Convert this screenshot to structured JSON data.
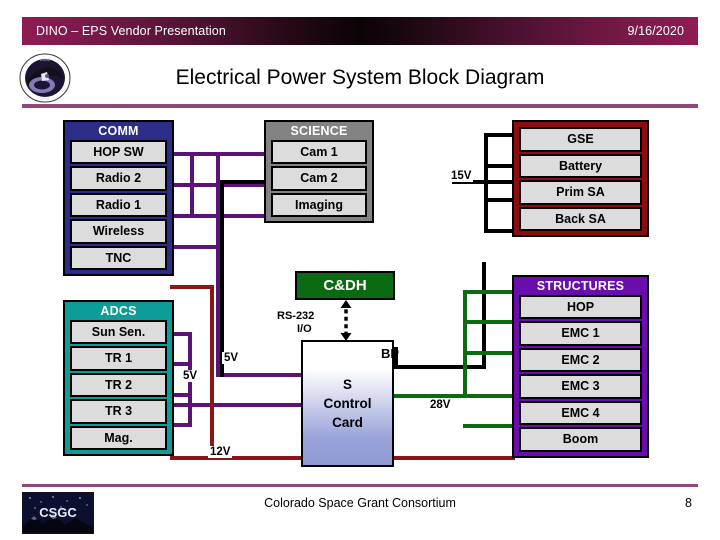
{
  "header": {
    "title": "DINO – EPS Vendor Presentation",
    "date": "9/16/2020"
  },
  "slide": {
    "title": "Electrical Power System Block Diagram"
  },
  "footer": {
    "organization": "Colorado Space Grant Consortium",
    "page_number": "8",
    "logo_text": "CSGC"
  },
  "diagram": {
    "groups": [
      {
        "name": "comm",
        "title": "COMM",
        "color": "#2b2d86",
        "items": [
          "HOP SW",
          "Radio 2",
          "Radio 1",
          "Wireless",
          "TNC"
        ]
      },
      {
        "name": "adcs",
        "title": "ADCS",
        "color": "#0e9c99",
        "items": [
          "Sun Sen.",
          "TR 1",
          "TR 2",
          "TR 3",
          "Mag."
        ]
      },
      {
        "name": "science",
        "title": "SCIENCE",
        "color": "#828282",
        "items": [
          "Cam 1",
          "Cam 2",
          "Imaging"
        ]
      },
      {
        "name": "gse",
        "title": "",
        "color": "#8c0d0d",
        "items": [
          "GSE",
          "Battery",
          "Prim SA",
          "Back SA"
        ]
      },
      {
        "name": "structures",
        "title": "STRUCTURES",
        "color": "#6a0dad",
        "items": [
          "HOP",
          "EMC 1",
          "EMC 2",
          "EMC 3",
          "EMC 4",
          "Boom"
        ]
      }
    ],
    "cdh_label": "C&DH",
    "control_card_lines": [
      "S",
      "Control",
      "Card"
    ],
    "interface_label_1": "RS-232",
    "interface_label_2": "I/O",
    "bp_label": "BP",
    "voltages": {
      "v15": "15V",
      "v5_a": "5V",
      "v5_b": "5V",
      "v12": "12V",
      "v28": "28V"
    },
    "wire_colors": {
      "signal_bus": "#5b1378",
      "power_15v": "#000000",
      "power_28v": "#0b6b13",
      "power_12v": "#8c1616"
    }
  }
}
